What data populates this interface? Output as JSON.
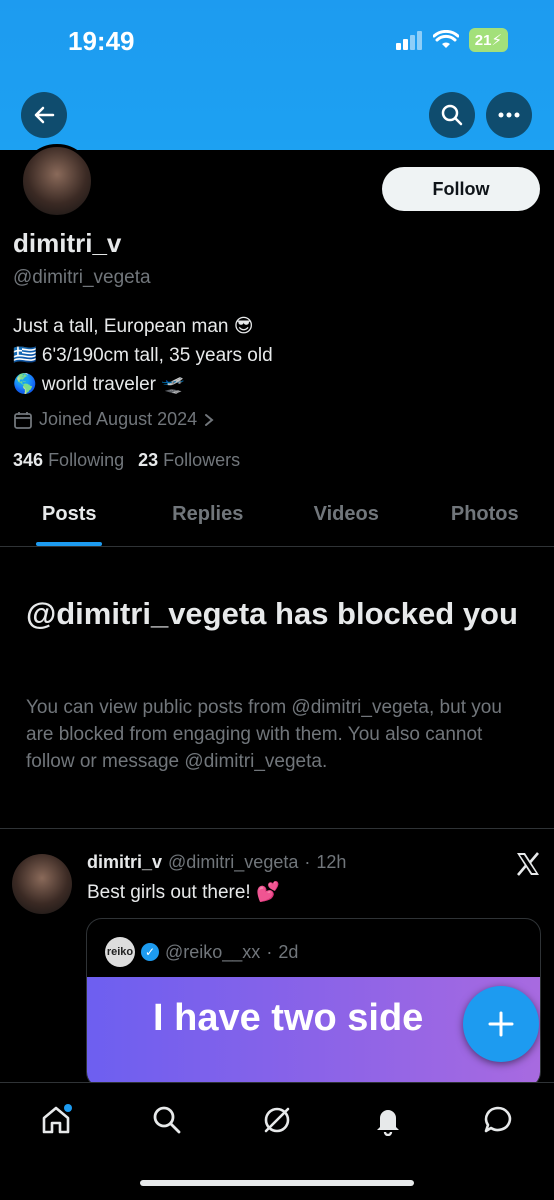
{
  "status_bar": {
    "time": "19:49",
    "battery": "21"
  },
  "profile": {
    "display_name": "dimitri_v",
    "handle": "@dimitri_vegeta",
    "bio_line1": "Just a tall, European man 😎",
    "bio_line2": "🇬🇷 6'3/190cm tall, 35 years old",
    "bio_line3": "🌎 world traveler 🛫",
    "joined": "Joined August 2024",
    "following_count": "346",
    "following_label": "Following",
    "followers_count": "23",
    "followers_label": "Followers",
    "follow_button": "Follow"
  },
  "tabs": [
    {
      "label": "Posts",
      "active": true
    },
    {
      "label": "Replies",
      "active": false
    },
    {
      "label": "Videos",
      "active": false
    },
    {
      "label": "Photos",
      "active": false
    }
  ],
  "blocked": {
    "title": "@dimitri_vegeta has blocked you",
    "description": "You can view public posts from @dimitri_vegeta, but you are blocked from engaging with them. You also cannot follow or message @dimitri_vegeta."
  },
  "post": {
    "author_name": "dimitri_v",
    "author_handle": "@dimitri_vegeta",
    "time": "12h",
    "text": "Best girls out there! 💕",
    "quote": {
      "avatar_text": "reiko",
      "handle": "@reiko__xx",
      "time": "2d",
      "image_text": "I have two side"
    }
  },
  "colors": {
    "accent": "#1d9bf0",
    "background": "#000000",
    "muted": "#71767b"
  }
}
